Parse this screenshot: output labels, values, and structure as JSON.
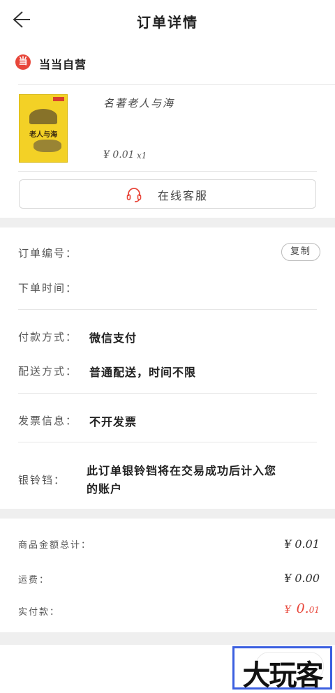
{
  "header": {
    "title": "订单详情"
  },
  "store": {
    "logo_char": "当",
    "name": "当当自营"
  },
  "product": {
    "title": "名著老人与海",
    "price": "¥ 0.01",
    "qty": "x1",
    "cover_title": "老人与海"
  },
  "service_button": {
    "label": "在线客服"
  },
  "order_info": {
    "order_no_label": "订单编号：",
    "copy_label": "复制",
    "order_time_label": "下单时间："
  },
  "payment": {
    "pay_label": "付款方式：",
    "pay_value": "微信支付",
    "delivery_label": "配送方式：",
    "delivery_value": "普通配送，时间不限"
  },
  "invoice": {
    "label": "发票信息：",
    "value": "不开发票"
  },
  "bell": {
    "label": "银铃铛：",
    "value_line1": "此订单银铃铛将在交易成功后计入您",
    "value_line2": "的账户"
  },
  "summary": {
    "goods_total_label": "商品金额总计：",
    "goods_total_value": "¥ 0.01",
    "shipping_label": "运费：",
    "shipping_value": "¥ 0.00",
    "paid_label": "实付款：",
    "paid_symbol": "¥",
    "paid_value_main": "0.",
    "paid_value_decimal": "01"
  },
  "watermark": {
    "text": "大玩客"
  },
  "colors": {
    "accent_red": "#e8463a",
    "band_gray": "#efefef",
    "watermark_blue": "#3b5fe0"
  }
}
